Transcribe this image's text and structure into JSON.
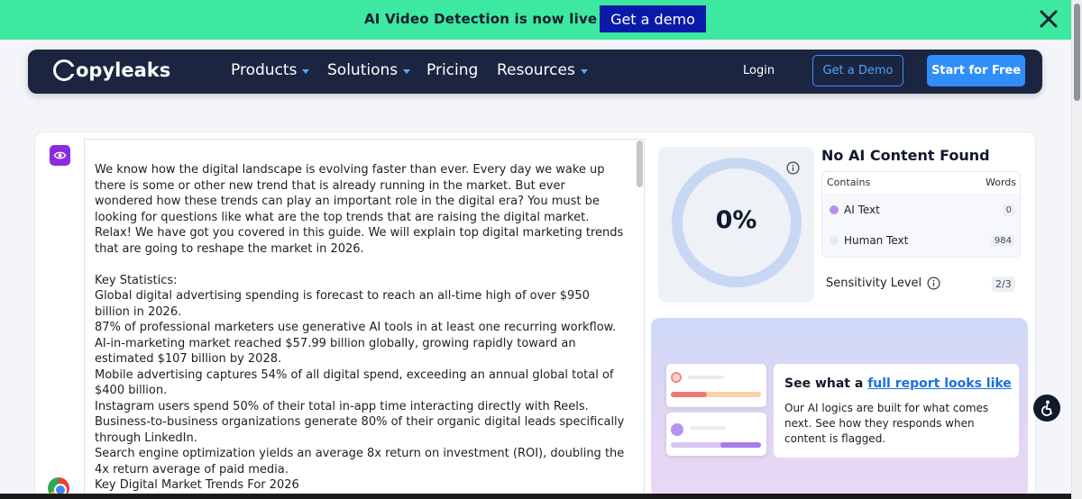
{
  "banner": {
    "text": "AI Video Detection is now live",
    "button_label": "Get a demo",
    "bg_color": "#3de8a0",
    "button_color": "#0a1aa8"
  },
  "nav": {
    "logo_text": "opyleaks",
    "items": [
      {
        "label": "Products",
        "has_dropdown": true
      },
      {
        "label": "Solutions",
        "has_dropdown": true
      },
      {
        "label": "Pricing",
        "has_dropdown": false
      },
      {
        "label": "Resources",
        "has_dropdown": true
      }
    ],
    "login_label": "Login",
    "demo_label": "Get a Demo",
    "start_label": "Start for Free",
    "bg_color": "#1c2540",
    "accent_color": "#2f8ef8"
  },
  "editor": {
    "paragraphs": [
      "We know how the digital landscape is evolving faster than ever. Every day we wake up there is some or other new trend that is already running in the market. But ever wondered how these trends can play an important role in the digital era? You must be looking for questions like what are the top trends that are raising the digital market. Relax! We have got you covered in this guide. We will explain top digital marketing trends that are going to reshape the market in 2026.",
      "",
      "Key Statistics:",
      "Global digital advertising spending is forecast to reach an all-time high of over $950 billion in 2026.",
      "87% of professional marketers use generative AI tools in at least one recurring workflow.",
      "AI-in-marketing market reached $57.99 billion globally, growing rapidly toward an estimated $107 billion by 2028.",
      "Mobile advertising captures 54% of all digital spend, exceeding an annual global total of $400 billion.",
      "Instagram users spend 50% of their total in-app time interacting directly with Reels.",
      "Business-to-business organizations generate 80% of their organic digital leads specifically through LinkedIn.",
      "Search engine optimization yields an average 8x return on investment (ROI), doubling the 4x return average of paid media.",
      "Key Digital Market Trends For 2026"
    ]
  },
  "result": {
    "percent": "0%",
    "title": "No AI Content Found",
    "col_contains": "Contains",
    "col_words": "Words",
    "rows": [
      {
        "label": "AI Text",
        "count": "0",
        "dot_color": "#b692f0"
      },
      {
        "label": "Human Text",
        "count": "984",
        "dot_color": "#e4ecfb"
      }
    ],
    "sensitivity_label": "Sensitivity Level",
    "sensitivity_value": "2/3",
    "ring_color": "#c8d8f4"
  },
  "promo": {
    "heading_prefix": "See what a",
    "heading_link": "full report looks like",
    "body": "Our AI logics are built for what comes next. See how they responds when content is flagged."
  },
  "icons": {
    "banner_close": "close-icon",
    "editor_badge": "eye-icon",
    "info": "info-icon",
    "accessibility": "accessibility-icon",
    "browser": "chrome-icon"
  }
}
